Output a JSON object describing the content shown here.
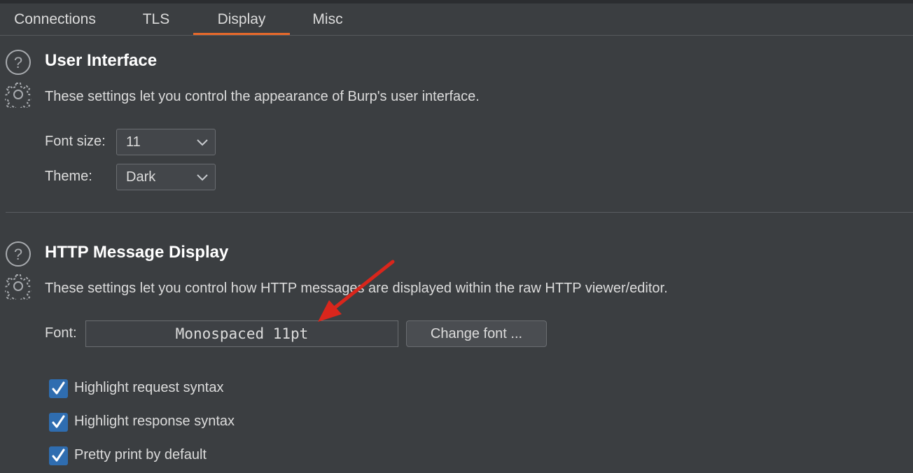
{
  "tabs": [
    {
      "label": "Connections",
      "active": false
    },
    {
      "label": "TLS",
      "active": false
    },
    {
      "label": "Display",
      "active": true
    },
    {
      "label": "Misc",
      "active": false
    }
  ],
  "user_interface": {
    "title": "User Interface",
    "description": "These settings let you control the appearance of Burp's user interface.",
    "font_size_label": "Font size:",
    "font_size_value": "11",
    "theme_label": "Theme:",
    "theme_value": "Dark"
  },
  "http_display": {
    "title": "HTTP Message Display",
    "description": "These settings let you control how HTTP messages are displayed within the raw HTTP viewer/editor.",
    "font_label": "Font:",
    "font_value": "Monospaced 11pt",
    "change_font_label": "Change font ...",
    "checkboxes": [
      {
        "label": "Highlight request syntax",
        "checked": true
      },
      {
        "label": "Highlight response syntax",
        "checked": true
      },
      {
        "label": "Pretty print by default",
        "checked": true
      }
    ]
  },
  "colors": {
    "accent": "#e8692a",
    "checkbox": "#2f6db0",
    "annotation_arrow": "#d9261c",
    "background": "#3b3e41"
  },
  "icons": {
    "help": "help-icon",
    "settings": "gear-icon",
    "dropdown": "chevron-down-icon",
    "check": "checkmark-icon"
  }
}
